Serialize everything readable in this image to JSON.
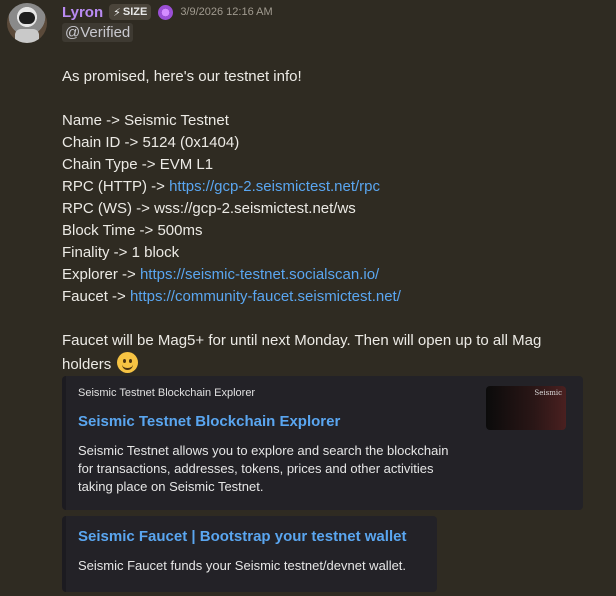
{
  "author": {
    "username": "Lyron",
    "tag_bolt": "⚡",
    "tag_label": "SIZE",
    "timestamp": "3/9/2026 12:16 AM"
  },
  "role_mention": "@Verified",
  "message": {
    "intro": "As promised, here's our testnet info!",
    "name_line": "Name -> Seismic Testnet",
    "chain_id_line": "Chain ID -> 5124 (0x1404)",
    "chain_type_line": "Chain Type -> EVM L1",
    "rpc_http_prefix": "RPC (HTTP) -> ",
    "rpc_http_url": "https://gcp-2.seismictest.net/rpc",
    "rpc_ws_line": "RPC (WS) -> wss://gcp-2.seismictest.net/ws",
    "block_time_line": "Block Time -> 500ms",
    "finality_line": "Finality -> 1 block",
    "explorer_prefix": "Explorer -> ",
    "explorer_url": "https://seismic-testnet.socialscan.io/",
    "faucet_prefix": "Faucet -> ",
    "faucet_url": "https://community-faucet.seismictest.net/",
    "closing_line1": "Faucet will be Mag5+ for until next Monday. Then will open up to all Mag",
    "closing_line2": "holders"
  },
  "embeds": [
    {
      "provider": "Seismic Testnet Blockchain Explorer",
      "title": "Seismic Testnet Blockchain Explorer",
      "description_lines": [
        "Seismic Testnet allows you to explore and search the blockchain",
        "for transactions, addresses, tokens, prices and other activities",
        "taking place on Seismic Testnet."
      ],
      "thumbnail_text": "Seismic"
    },
    {
      "title": "Seismic Faucet | Bootstrap your testnet wallet",
      "description": "Seismic Faucet funds your Seismic testnet/devnet wallet."
    }
  ],
  "colors": {
    "background": "#2f2b22",
    "username": "#b98bf2",
    "link": "#5aa6f0",
    "embed_bg": "#232227"
  }
}
